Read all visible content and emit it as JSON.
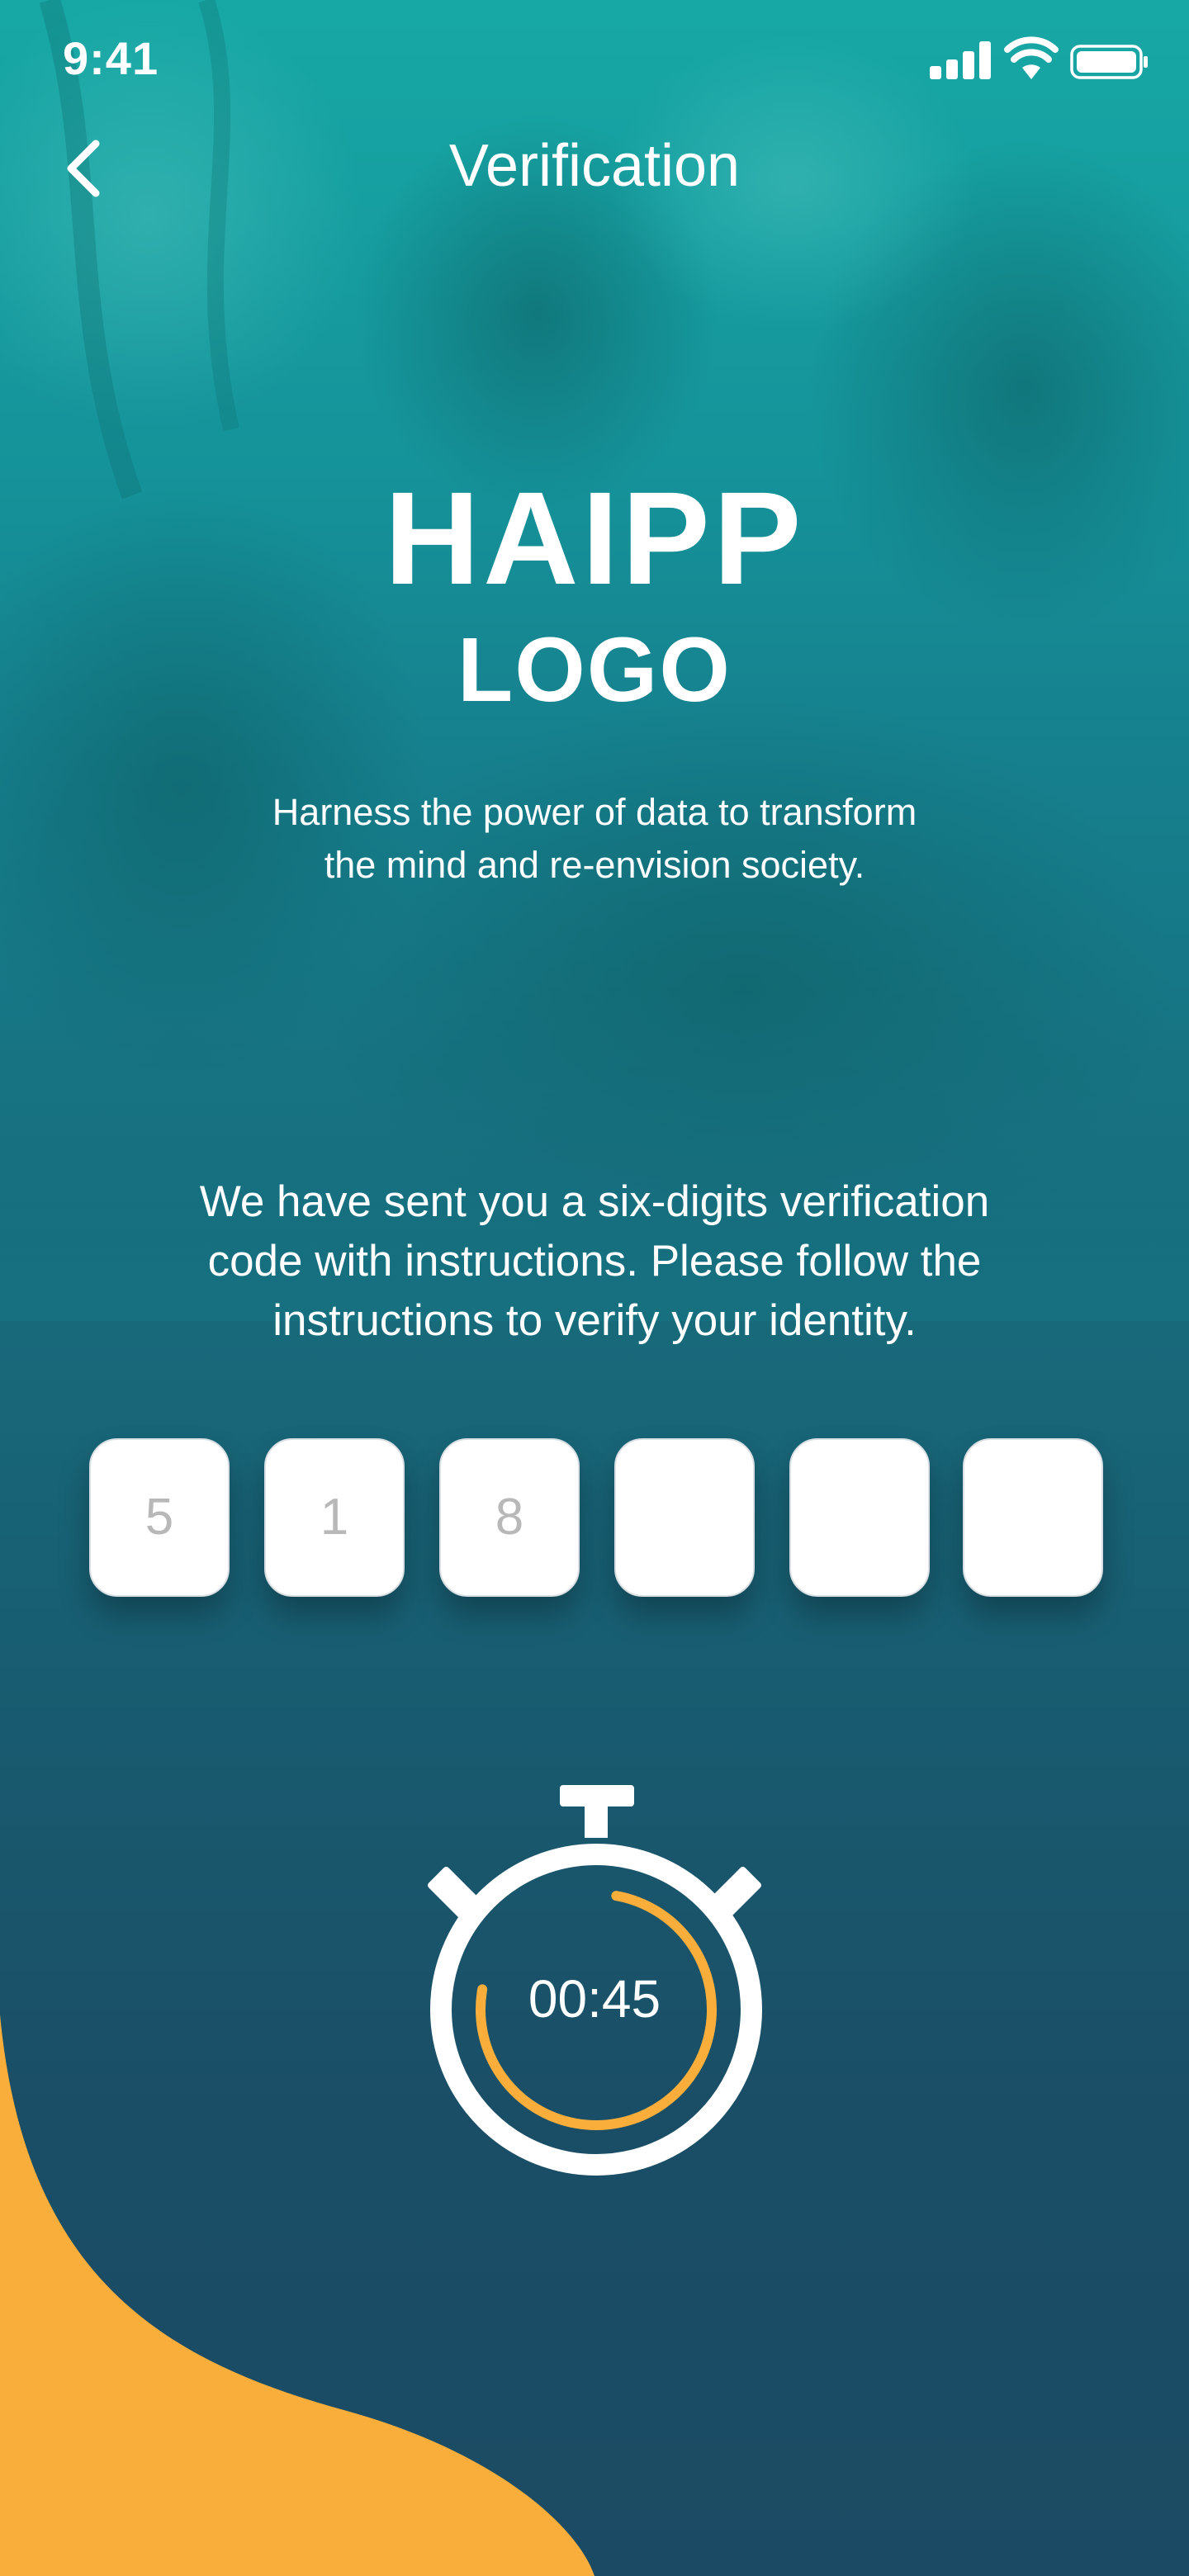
{
  "status_bar": {
    "time": "9:41",
    "icons": [
      "signal-icon",
      "wifi-icon",
      "battery-icon"
    ]
  },
  "nav": {
    "title": "Verification",
    "back_icon": "chevron-left-icon"
  },
  "logo": {
    "line1": "HAIPP",
    "line2": "LOGO"
  },
  "tagline": {
    "line1": "Harness the power of data to transform",
    "line2": "the mind and re-envision society."
  },
  "instructions": {
    "line1": "We have sent you a six-digits verification",
    "line2": "code with instructions. Please follow the",
    "line3": "instructions to verify your identity."
  },
  "code": {
    "digits": [
      "5",
      "1",
      "8",
      "",
      "",
      ""
    ]
  },
  "timer": {
    "remaining": "00:45",
    "icon": "stopwatch-icon",
    "progress_fraction": 0.75
  },
  "colors": {
    "accent": "#F9AE3B",
    "teal": "#17A8A5",
    "navy": "#1B4B64",
    "white": "#FFFFFF"
  }
}
